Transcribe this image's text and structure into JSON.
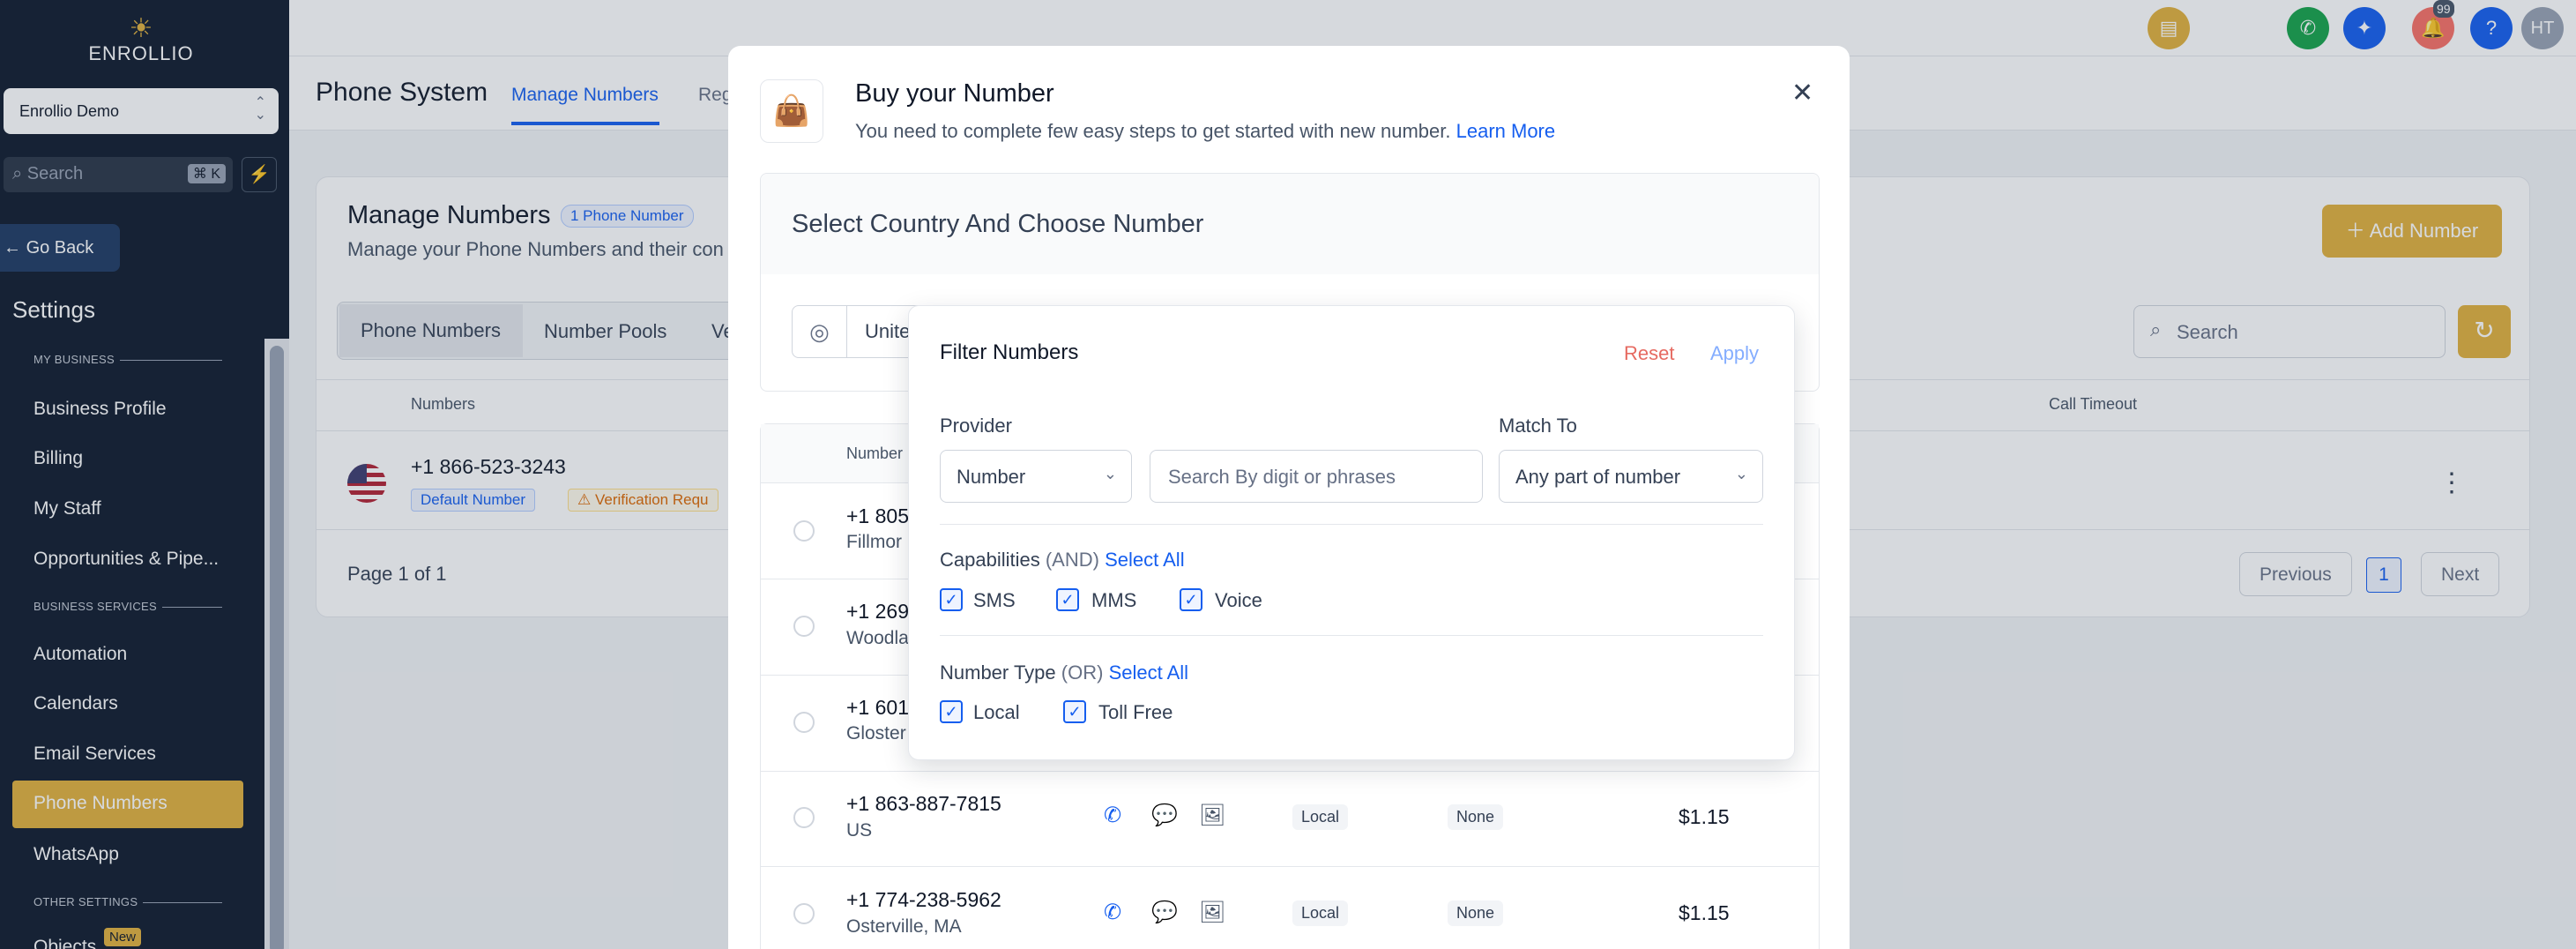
{
  "sidebar": {
    "brand": "ENROLLIO",
    "location": "Enrollio Demo",
    "search_placeholder": "Search",
    "search_shortcut": "⌘ K",
    "go_back": "Go Back",
    "settings_title": "Settings",
    "sections": {
      "my_business": "MY BUSINESS",
      "business_services": "BUSINESS SERVICES",
      "other_settings": "OTHER SETTINGS"
    },
    "items": [
      {
        "label": "Business Profile"
      },
      {
        "label": "Billing"
      },
      {
        "label": "My Staff"
      },
      {
        "label": "Opportunities & Pipe..."
      },
      {
        "label": "Automation"
      },
      {
        "label": "Calendars"
      },
      {
        "label": "Email Services"
      },
      {
        "label": "Phone Numbers",
        "active": true
      },
      {
        "label": "WhatsApp"
      },
      {
        "label": "Objects"
      }
    ],
    "new_badge": "New"
  },
  "topbar": {
    "notification_count": "99",
    "help": "?",
    "avatar": "HT"
  },
  "header": {
    "title": "Phone System",
    "tabs": [
      "Manage Numbers",
      "Reg"
    ]
  },
  "manage": {
    "title": "Manage Numbers",
    "count_pill": "1 Phone Number",
    "subtitle": "Manage your Phone Numbers and their con",
    "add_button": "Add Number",
    "tabs": [
      "Phone Numbers",
      "Number Pools",
      "Ve"
    ],
    "search_placeholder": "Search",
    "columns": [
      "Numbers",
      "Call Timeout"
    ],
    "number": "+1 866-523-3243",
    "default_badge": "Default Number",
    "verify_badge": "Verification Requ",
    "page_info": "Page 1 of 1",
    "prev": "Previous",
    "page": "1",
    "next": "Next"
  },
  "modal": {
    "title": "Buy your Number",
    "subtitle": "You need to complete few easy steps to get started with new number.",
    "learn_more": "Learn More",
    "section_title": "Select Country And Choose Number",
    "country_text": "Unite",
    "table_header": "Number",
    "rows": [
      {
        "number": "+1 805",
        "location": "Fillmor"
      },
      {
        "number": "+1 269",
        "location": "Woodla"
      },
      {
        "number": "+1 601",
        "location": "Gloster"
      },
      {
        "number": "+1 863-887-7815",
        "location": "US",
        "type": "Local",
        "address": "None",
        "price": "$1.15"
      },
      {
        "number": "+1 774-238-5962",
        "location": "Osterville, MA",
        "type": "Local",
        "address": "None",
        "price": "$1.15"
      }
    ]
  },
  "filter": {
    "title": "Filter Numbers",
    "reset": "Reset",
    "apply": "Apply",
    "provider_label": "Provider",
    "provider_value": "Number",
    "search_placeholder": "Search By digit or phrases",
    "match_label": "Match To",
    "match_value": "Any part of number",
    "capabilities_label": "Capabilities",
    "capabilities_mode": "(AND)",
    "select_all": "Select All",
    "capabilities": [
      "SMS",
      "MMS",
      "Voice"
    ],
    "type_label": "Number Type",
    "type_mode": "(OR)",
    "types": [
      "Local",
      "Toll Free"
    ]
  },
  "colors": {
    "accent": "#e2b13c",
    "link": "#155eef",
    "sidebar_bg": "#0f1b2d"
  }
}
